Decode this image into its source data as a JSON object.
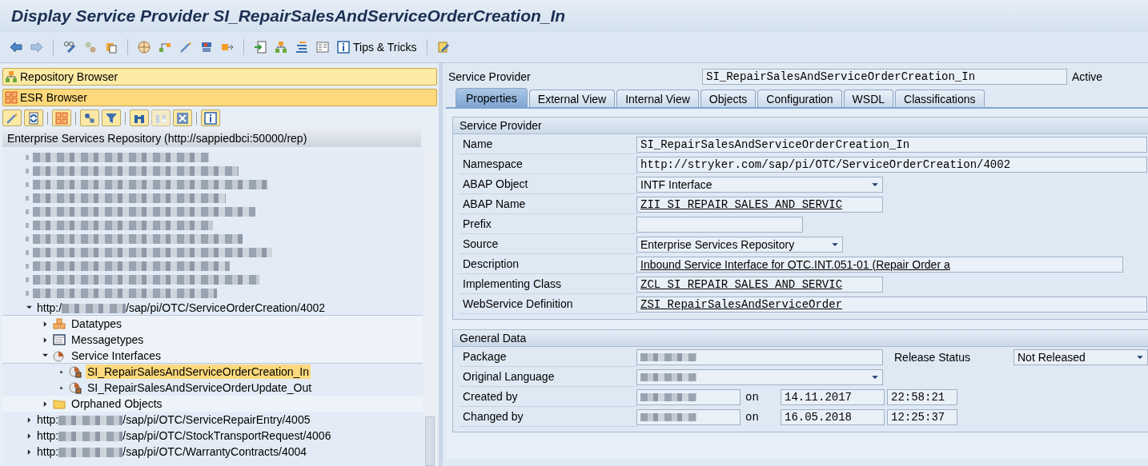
{
  "window": {
    "title": "Display Service Provider SI_RepairSalesAndServiceOrderCreation_In"
  },
  "toolbar": {
    "tips_label": "Tips & Tricks"
  },
  "navigator": {
    "panels": [
      {
        "label": "Repository Browser",
        "selected": false,
        "kind": "repository"
      },
      {
        "label": "ESR Browser",
        "selected": true,
        "kind": "esr"
      }
    ],
    "tree_header": "Enterprise Services Repository (http://sappiedbci:50000/rep)",
    "tree": [
      {
        "kind": "redacted"
      },
      {
        "kind": "redacted"
      },
      {
        "kind": "redacted"
      },
      {
        "kind": "redacted"
      },
      {
        "kind": "redacted"
      },
      {
        "kind": "redacted"
      },
      {
        "kind": "redacted"
      },
      {
        "kind": "redacted"
      },
      {
        "kind": "redacted"
      },
      {
        "kind": "redacted"
      },
      {
        "kind": "redacted"
      },
      {
        "kind": "namespace",
        "prefix": "http:/",
        "suffix": "/sap/pi/OTC/ServiceOrderCreation/4002",
        "expanded": true,
        "children": [
          {
            "kind": "datatypes",
            "label": "Datatypes",
            "expanded": false
          },
          {
            "kind": "messagetypes",
            "label": "Messagetypes",
            "expanded": false
          },
          {
            "kind": "service_interfaces",
            "label": "Service Interfaces",
            "expanded": true,
            "children": [
              {
                "kind": "interface",
                "label": "SI_RepairSalesAndServiceOrderCreation_In",
                "selected": true
              },
              {
                "kind": "interface",
                "label": "SI_RepairSalesAndServiceOrderUpdate_Out",
                "selected": false
              }
            ]
          },
          {
            "kind": "folder",
            "label": "Orphaned Objects",
            "expanded": false
          }
        ]
      },
      {
        "kind": "namespace",
        "prefix": "http:",
        "suffix": "/sap/pi/OTC/ServiceRepairEntry/4005",
        "expanded": false
      },
      {
        "kind": "namespace",
        "prefix": "http:",
        "suffix": "/sap/pi/OTC/StockTransportRequest/4006",
        "expanded": false
      },
      {
        "kind": "namespace",
        "prefix": "http:",
        "suffix": "/sap/pi/OTC/WarrantyContracts/4004",
        "expanded": false
      }
    ]
  },
  "object_header": {
    "label": "Service Provider",
    "value": "SI_RepairSalesAndServiceOrderCreation_In",
    "status": "Active"
  },
  "tabs": [
    {
      "label": "Properties",
      "selected": true
    },
    {
      "label": "External View",
      "selected": false
    },
    {
      "label": "Internal View",
      "selected": false
    },
    {
      "label": "Objects",
      "selected": false
    },
    {
      "label": "Configuration",
      "selected": false
    },
    {
      "label": "WSDL",
      "selected": false
    },
    {
      "label": "Classifications",
      "selected": false
    }
  ],
  "service_provider": {
    "title": "Service Provider",
    "fields": [
      {
        "label": "Name",
        "value": "SI_RepairSalesAndServiceOrderCreation_In",
        "kind": "mono",
        "linked": false
      },
      {
        "label": "Namespace",
        "value": "http://stryker.com/sap/pi/OTC/ServiceOrderCreation/4002",
        "kind": "mono",
        "linked": false
      },
      {
        "label": "ABAP Object",
        "value": "INTF Interface",
        "kind": "dropdown",
        "linked": false
      },
      {
        "label": "ABAP Name",
        "value": "ZII_SI_REPAIR_SALES_AND_SERVIC",
        "kind": "mono",
        "linked": true
      },
      {
        "label": "Prefix",
        "kind": "mono"
      },
      {
        "label": "Source",
        "value": "Enterprise Services Repository",
        "kind": "dropdown",
        "linked": false
      },
      {
        "label": "Description",
        "value": "Inbound Service Interface for OTC.INT.051-01 (Repair Order a",
        "kind": "text",
        "linked": true
      },
      {
        "label": "Implementing Class",
        "value": "ZCL_SI_REPAIR_SALES_AND_SERVIC",
        "kind": "mono",
        "linked": true
      },
      {
        "label": "WebService Definition",
        "value": "ZSI_RepairSalesAndServiceOrder",
        "kind": "mono",
        "linked": true
      }
    ]
  },
  "general_data": {
    "title": "General Data",
    "rows": [
      {
        "label": "Package",
        "kind": "redacted",
        "side_label": "Release Status",
        "side_value": "Not Released"
      },
      {
        "label": "Original Language",
        "kind": "redacted_dropdown"
      },
      {
        "label": "Created by",
        "kind": "redacted",
        "on_label": "on",
        "date": "14.11.2017",
        "time": "22:58:21"
      },
      {
        "label": "Changed by",
        "kind": "redacted",
        "on_label": "on",
        "date": "16.05.2018",
        "time": "12:25:37"
      }
    ]
  }
}
